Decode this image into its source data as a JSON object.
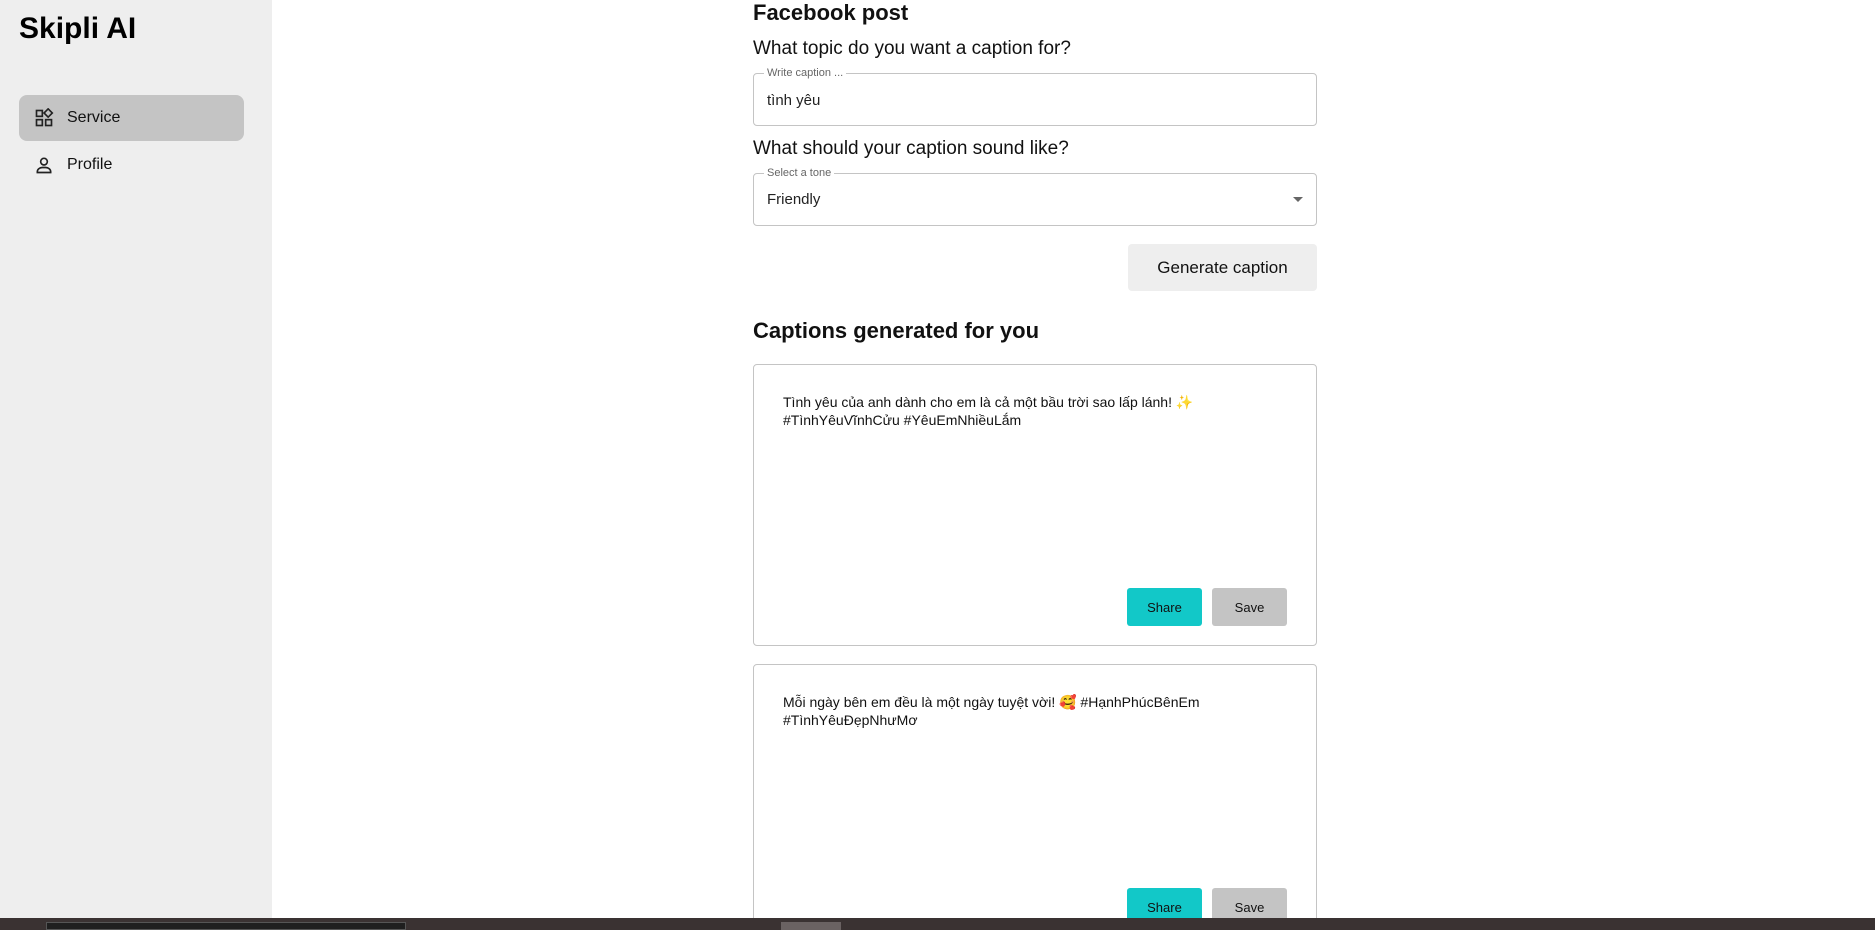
{
  "sidebar": {
    "brand": "Skipli AI",
    "items": [
      {
        "label": "Service",
        "icon": "grid-icon",
        "active": true
      },
      {
        "label": "Profile",
        "icon": "user-icon",
        "active": false
      }
    ]
  },
  "form": {
    "title": "Facebook post",
    "topic_question": "What topic do you want a caption for?",
    "topic_legend": "Write caption ...",
    "topic_value": "tình yêu",
    "tone_question": "What should your caption sound like?",
    "tone_legend": "Select a tone",
    "tone_value": "Friendly",
    "generate_label": "Generate caption"
  },
  "results": {
    "title": "Captions generated for you",
    "captions": [
      {
        "text": "Tình yêu của anh dành cho em là cả một bầu trời sao lấp lánh! ✨ #TìnhYêuVĩnhCửu #YêuEmNhiềuLắm",
        "share_label": "Share",
        "save_label": "Save"
      },
      {
        "text": "Mỗi ngày bên em đều là một ngày tuyệt vời! 🥰 #HạnhPhúcBênEm #TìnhYêuĐẹpNhưMơ",
        "share_label": "Share",
        "save_label": "Save"
      }
    ]
  },
  "colors": {
    "sidebar_bg": "#eeeeee",
    "active_item_bg": "#c4c4c4",
    "share_button": "#12c8c8",
    "save_button": "#c4c4c4"
  }
}
